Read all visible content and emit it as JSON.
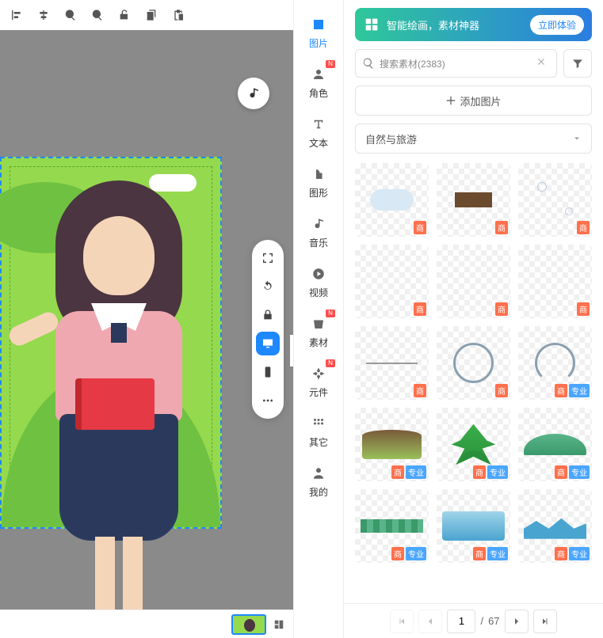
{
  "categories": [
    {
      "key": "image",
      "label": "图片",
      "active": true,
      "new": false
    },
    {
      "key": "role",
      "label": "角色",
      "active": false,
      "new": true
    },
    {
      "key": "text",
      "label": "文本",
      "active": false,
      "new": false
    },
    {
      "key": "shape",
      "label": "图形",
      "active": false,
      "new": false
    },
    {
      "key": "music",
      "label": "音乐",
      "active": false,
      "new": false
    },
    {
      "key": "video",
      "label": "视频",
      "active": false,
      "new": false
    },
    {
      "key": "material",
      "label": "素材",
      "active": false,
      "new": true
    },
    {
      "key": "component",
      "label": "元件",
      "active": false,
      "new": true
    },
    {
      "key": "other",
      "label": "其它",
      "active": false,
      "new": false
    },
    {
      "key": "mine",
      "label": "我的",
      "active": false,
      "new": false
    }
  ],
  "promo": {
    "text": "智能绘画，素材神器",
    "button": "立即体验"
  },
  "search": {
    "placeholder": "搜索素材(2383)"
  },
  "add_button": "添加图片",
  "dropdown": {
    "selected": "自然与旅游"
  },
  "assets": [
    {
      "tags": [
        "s"
      ],
      "type": "cloud"
    },
    {
      "tags": [
        "s"
      ],
      "type": "wood"
    },
    {
      "tags": [
        "s"
      ],
      "type": "bubbles"
    },
    {
      "tags": [
        "s"
      ],
      "type": "blank"
    },
    {
      "tags": [
        "s"
      ],
      "type": "blank"
    },
    {
      "tags": [
        "s"
      ],
      "type": "blank"
    },
    {
      "tags": [
        "s"
      ],
      "type": "line"
    },
    {
      "tags": [
        "s"
      ],
      "type": "circle"
    },
    {
      "tags": [
        "s",
        "z"
      ],
      "type": "ring"
    },
    {
      "tags": [
        "s",
        "z"
      ],
      "type": "field"
    },
    {
      "tags": [
        "s",
        "z"
      ],
      "type": "plant"
    },
    {
      "tags": [
        "s",
        "z"
      ],
      "type": "mountain"
    },
    {
      "tags": [
        "s",
        "z"
      ],
      "type": "strip"
    },
    {
      "tags": [
        "s",
        "z"
      ],
      "type": "sea"
    },
    {
      "tags": [
        "s",
        "z"
      ],
      "type": "wave"
    }
  ],
  "tag_labels": {
    "s": "商",
    "z": "专业"
  },
  "pagination": {
    "current": "1",
    "total": "67",
    "sep": "/"
  }
}
